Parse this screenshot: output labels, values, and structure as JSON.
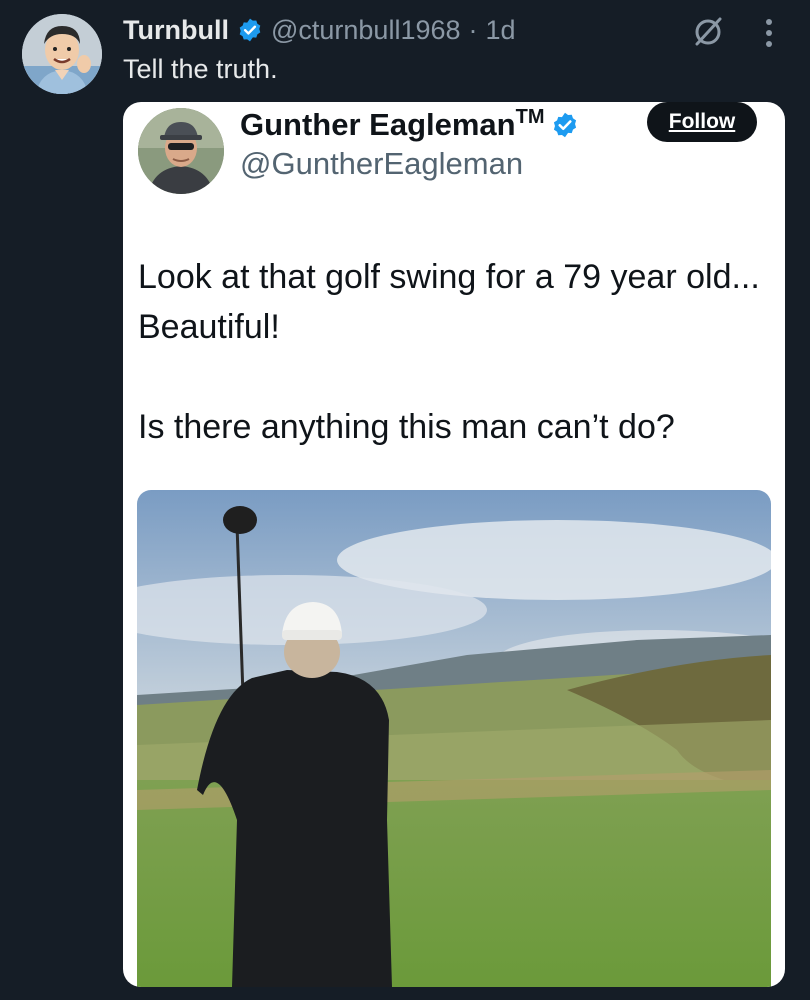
{
  "tweet": {
    "author_name": "Turnbull",
    "handle": "@cturnbull1968",
    "separator": "·",
    "time": "1d",
    "text": "Tell the truth.",
    "avatar_icon": "cartoon-man-avatar",
    "actions": {
      "grok_icon": "grok-slash-circle-icon",
      "more_icon": "vertical-ellipsis-icon"
    }
  },
  "quoted": {
    "name": "Gunther Eagleman",
    "trademark": "TM",
    "handle": "@GuntherEagleman",
    "follow_label": "Follow",
    "avatar_icon": "man-in-cap-avatar",
    "text_lines": [
      "Look at that golf swing for a 79 year old... Beautiful!",
      "Is there anything this man can’t do?"
    ],
    "media_icon": "golf-course-photo"
  },
  "colors": {
    "background": "#151d26",
    "verified_blue": "#1d9bf0",
    "card_background": "#ffffff",
    "follow_button": "#0f1419"
  }
}
